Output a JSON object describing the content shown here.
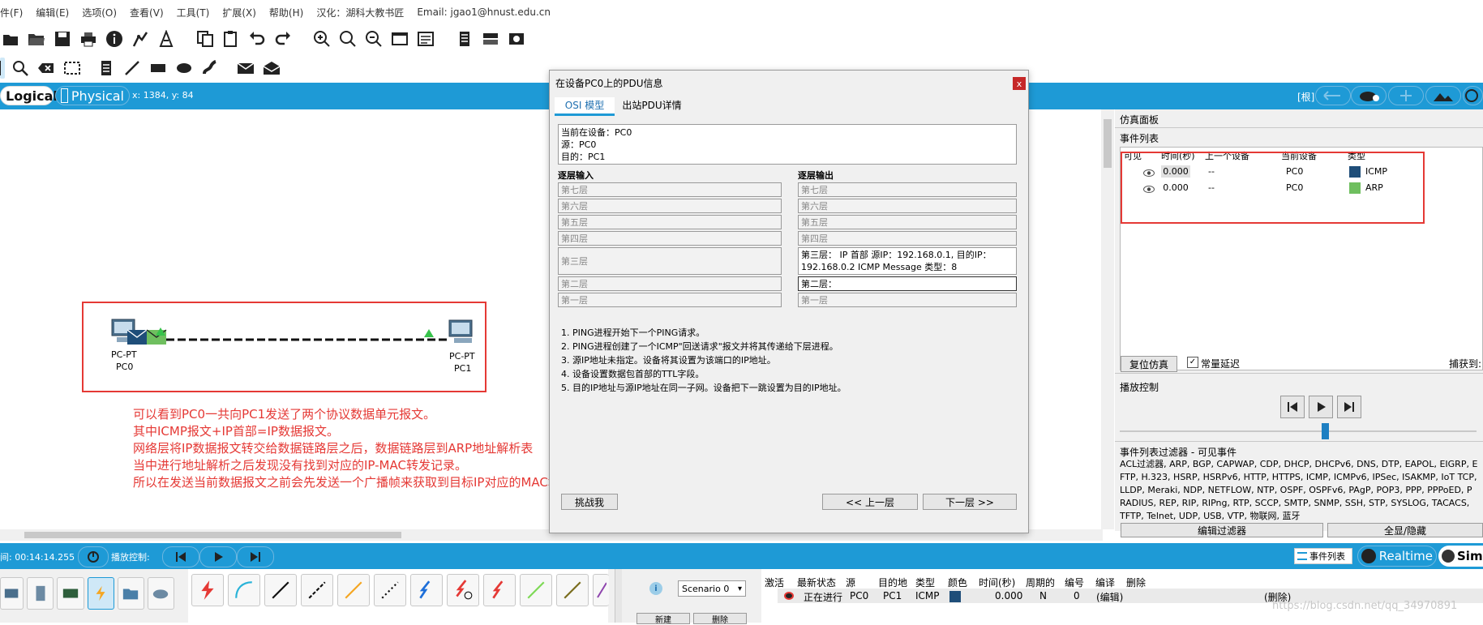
{
  "menu": [
    "件(F)",
    "编辑(E)",
    "选项(O)",
    "查看(V)",
    "工具(T)",
    "扩展(X)",
    "帮助(H)",
    "汉化：湖科大教书匠",
    "Email: jgao1@hnust.edu.cn"
  ],
  "modebar": {
    "logical": "Logical",
    "physical": "Physical",
    "coords": "x: 1384, y: 84",
    "root": "[根]"
  },
  "devices": [
    {
      "type": "PC-PT",
      "name": "PC0"
    },
    {
      "type": "PC-PT",
      "name": "PC1"
    }
  ],
  "annotations": [
    "可以看到PC0一共向PC1发送了两个协议数据单元报文。",
    "其中ICMP报文+IP首部=IP数据报文。",
    "网络层将IP数据报文转交给数据链路层之后，数据链路层到ARP地址解析表",
    "当中进行地址解析之后发现没有找到对应的IP-MAC转发记录。",
    "所以在发送当前数据报文之前会先发送一个广播帧来获取到目标IP对应的MAC地址"
  ],
  "dialog": {
    "title": "在设备PC0上的PDU信息",
    "close": "x",
    "tabs": [
      "OSI 模型",
      "出站PDU详情"
    ],
    "info": [
      "当前在设备：PC0",
      "源：PC0",
      "目的：PC1"
    ],
    "in_header": "逐层输入",
    "out_header": "逐层输出",
    "in_layers": [
      "第七层",
      "第六层",
      "第五层",
      "第四层",
      "第三层",
      "第二层",
      "第一层"
    ],
    "out_layers": [
      "第七层",
      "第六层",
      "第五层",
      "第四层",
      "第三层：  IP 首部 源IP：192.168.0.1, 目的IP：192.168.0.2 ICMP Message 类型：8",
      "第二层：",
      "第一层"
    ],
    "steps": [
      "1. PING进程开始下一个PING请求。",
      "2. PING进程创建了一个ICMP\"回送请求\"报文并将其传递给下层进程。",
      "3. 源IP地址未指定。设备将其设置为该端口的IP地址。",
      "4. 设备设置数据包首部的TTL字段。",
      "5. 目的IP地址与源IP地址在同一子网。设备把下一跳设置为目的IP地址。"
    ],
    "challenge": "挑战我",
    "prev": "<< 上一层",
    "next": "下一层 >>"
  },
  "sim": {
    "title": "仿真面板",
    "event_list": "事件列表",
    "columns": [
      "可见",
      "时间(秒)",
      "上一个设备",
      "当前设备",
      "类型"
    ],
    "events": [
      {
        "time": "0.000",
        "last": "--",
        "current": "PC0",
        "type": "ICMP",
        "color": "#1f4e79"
      },
      {
        "time": "0.000",
        "last": "--",
        "current": "PC0",
        "type": "ARP",
        "color": "#6fbf5f"
      }
    ],
    "reset": "复位仿真",
    "const_delay": "常量延迟",
    "capture": "捕获到:",
    "playback": "播放控制",
    "filter_title": "事件列表过滤器 - 可见事件",
    "filter_text": [
      "ACL过滤器, ARP, BGP, CAPWAP, CDP, DHCP, DHCPv6, DNS, DTP, EAPOL, EIGRP, E",
      "FTP, H.323, HSRP, HSRPv6, HTTP, HTTPS, ICMP, ICMPv6, IPSec, ISAKMP, IoT TCP,",
      "LLDP, Meraki, NDP, NETFLOW, NTP, OSPF, OSPFv6, PAgP, POP3, PPP, PPPoED, P",
      "RADIUS, REP, RIP, RIPng, RTP, SCCP, SMTP, SNMP, SSH, STP, SYSLOG, TACACS,",
      "TFTP, Telnet, UDP, USB, VTP, 物联网, 蓝牙"
    ],
    "edit_filter": "编辑过滤器",
    "show_all": "全显/隐藏"
  },
  "statusbar": {
    "time": "间: 00:14:14.255",
    "playback": "播放控制:",
    "event_list": "事件列表",
    "realtime": "Realtime",
    "sim": "Sim"
  },
  "bottom": {
    "scenario": "Scenario 0",
    "new": "新建",
    "delete": "删除",
    "pdu_columns": [
      "激活",
      "最新状态",
      "源",
      "目的地",
      "类型",
      "颜色",
      "时间(秒)",
      "周期的",
      "编号",
      "编译",
      "删除"
    ],
    "pdu_row": {
      "status": "正在进行",
      "src": "PC0",
      "dst": "PC1",
      "type": "ICMP",
      "color": "#1f4e79",
      "time": "0.000",
      "periodic": "N",
      "num": "0",
      "edit": "(编辑)",
      "delete": "(删除)"
    },
    "watermark": "https://blog.csdn.net/qq_34970891"
  }
}
